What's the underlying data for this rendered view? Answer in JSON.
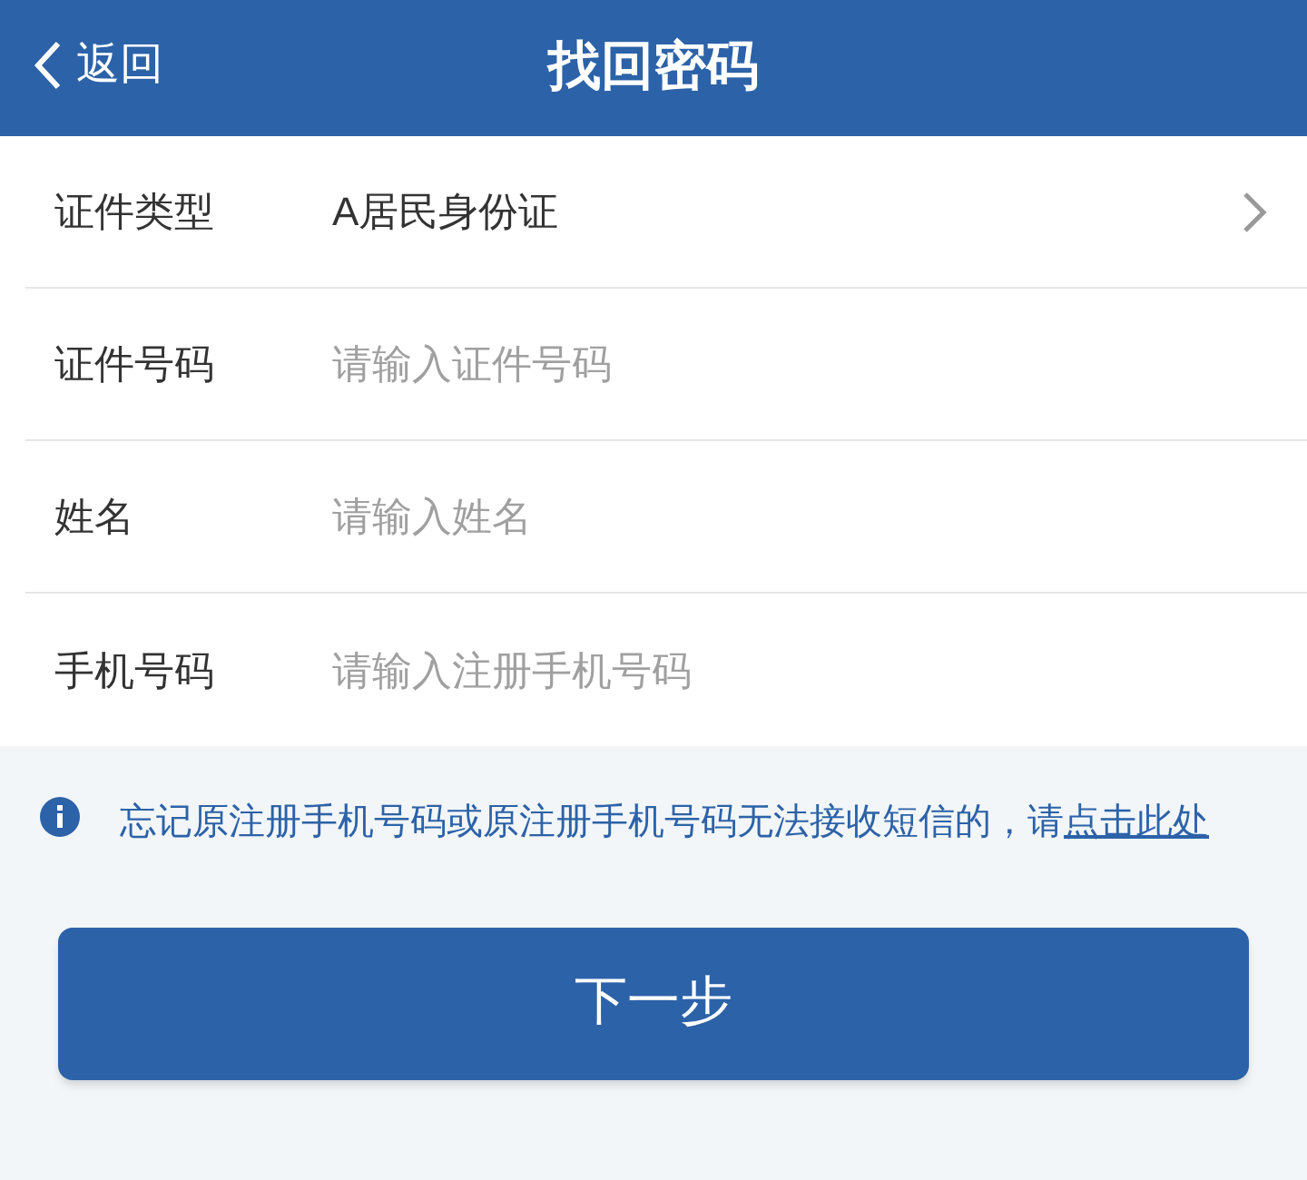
{
  "header": {
    "back": "返回",
    "title": "找回密码"
  },
  "fields": [
    {
      "kind": "select",
      "label": "证件类型",
      "value": "A居民身份证"
    },
    {
      "kind": "input",
      "label": "证件号码",
      "placeholder": "请输入证件号码"
    },
    {
      "kind": "input",
      "label": "姓名",
      "placeholder": "请输入姓名"
    },
    {
      "kind": "input",
      "label": "手机号码",
      "placeholder": "请输入注册手机号码"
    }
  ],
  "notice": {
    "text": "忘记原注册手机号码或原注册手机号码无法接收短信的，请",
    "link": "点击此处"
  },
  "next_button": "下一步"
}
